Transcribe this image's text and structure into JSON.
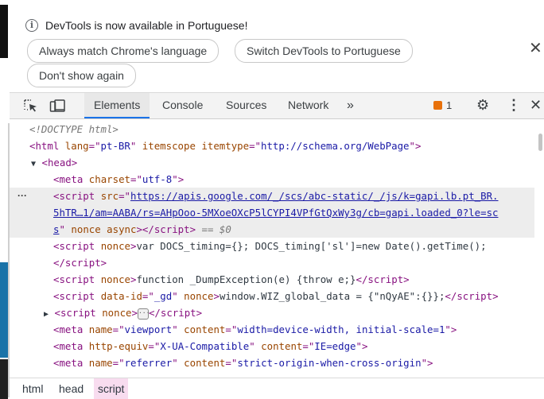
{
  "infobar": {
    "message": "DevTools is now available in Portuguese!",
    "buttons": [
      "Always match Chrome's language",
      "Switch DevTools to Portuguese",
      "Don't show again"
    ],
    "close_glyph": "✕"
  },
  "toolbar": {
    "inspect_icon": "inspect-element-icon",
    "device_icon": "device-toolbar-icon",
    "tabs": [
      "Elements",
      "Console",
      "Sources",
      "Network"
    ],
    "active_tab": "Elements",
    "more_tabs_glyph": "»",
    "issues_count": "1",
    "issues_icon": "issues-flag-icon",
    "settings_icon": "gear-icon",
    "menu_icon": "more-vertical-icon",
    "close_icon": "close-icon",
    "accent": "#1a73e8"
  },
  "dom": {
    "doctype": "<!DOCTYPE html>",
    "html_lang": "pt-BR",
    "html_itemtype": "http://schema.org/WebPage",
    "meta_charset": "utf-8",
    "script_src_1": "https://apis.google.com/_/scs/abc-static/_/js/k=gapi.lb.pt_BR.",
    "script_src_2": "5hTR…1/am=AABA/rs=AHpOoo-5MXoeOXcP5lCYPI4VPfGtQxWy3g/cb=gapi.loaded_0?le=sc",
    "script_src_3": "s",
    "selected_marker": "== $0",
    "docs_timing_1": "var DOCS_timing={}; DOCS_timing['sl']=new Date().getTime();",
    "dump_exception": "function _DumpException(e) {throw e;}",
    "data_id": "_gd",
    "wiz_data": "window.WIZ_global_data = {\"nQyAE\":{}};",
    "viewport_name": "viewport",
    "viewport_content": "width=device-width, initial-scale=1",
    "ua_equiv": "X-UA-Compatible",
    "ua_content": "IE=edge",
    "referrer_name": "referrer",
    "referrer_content": "strict-origin-when-cross-origin"
  },
  "breadcrumbs": [
    "html",
    "head",
    "script"
  ],
  "active_breadcrumb": "script"
}
